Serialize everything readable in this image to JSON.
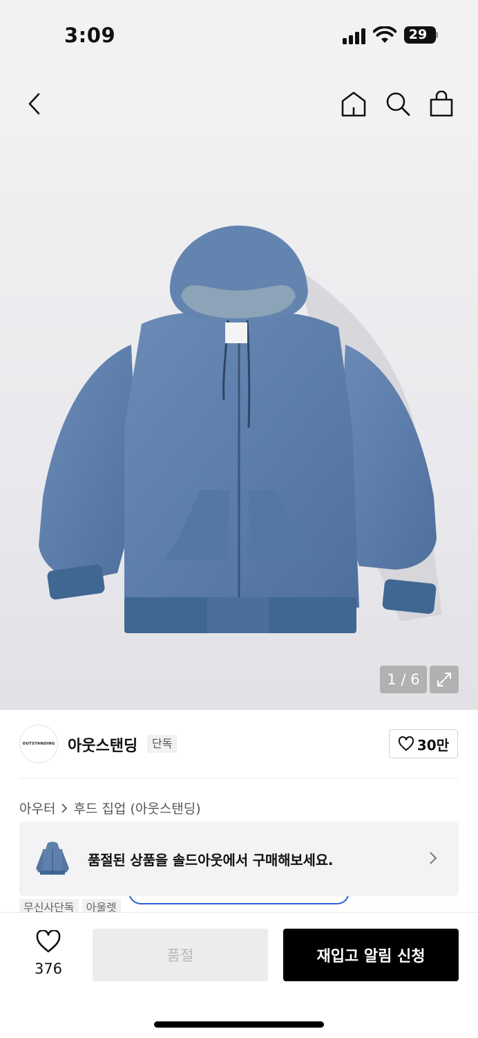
{
  "status_bar": {
    "time": "3:09",
    "battery": "29"
  },
  "nav": {
    "back_icon": "chevron-left-icon",
    "home_icon": "home-icon",
    "search_icon": "search-icon",
    "cart_icon": "shopping-bag-icon"
  },
  "gallery": {
    "counter": "1 / 6",
    "expand_icon": "expand-icon"
  },
  "brand": {
    "logo_text": "OUTSTANDING",
    "name": "아웃스탠딩",
    "badge": "단독",
    "likes": "30만"
  },
  "breadcrumb": {
    "category": "아우터",
    "subcategory": "후드 집업 (아웃스탠딩)"
  },
  "resale_banner": {
    "text": "품절된 상품을 솔드아웃에서 구매해보세요."
  },
  "tags": [
    "무신사단독",
    "아울렛"
  ],
  "bottom_bar": {
    "wish_count": "376",
    "soldout_label": "품절",
    "restock_label": "재입고 알림 신청"
  },
  "colors": {
    "accent_black": "#000000",
    "jacket_blue": "#5f80ad",
    "banner_bg": "#f3f3f5",
    "outline_blue": "#2d5fd6"
  }
}
